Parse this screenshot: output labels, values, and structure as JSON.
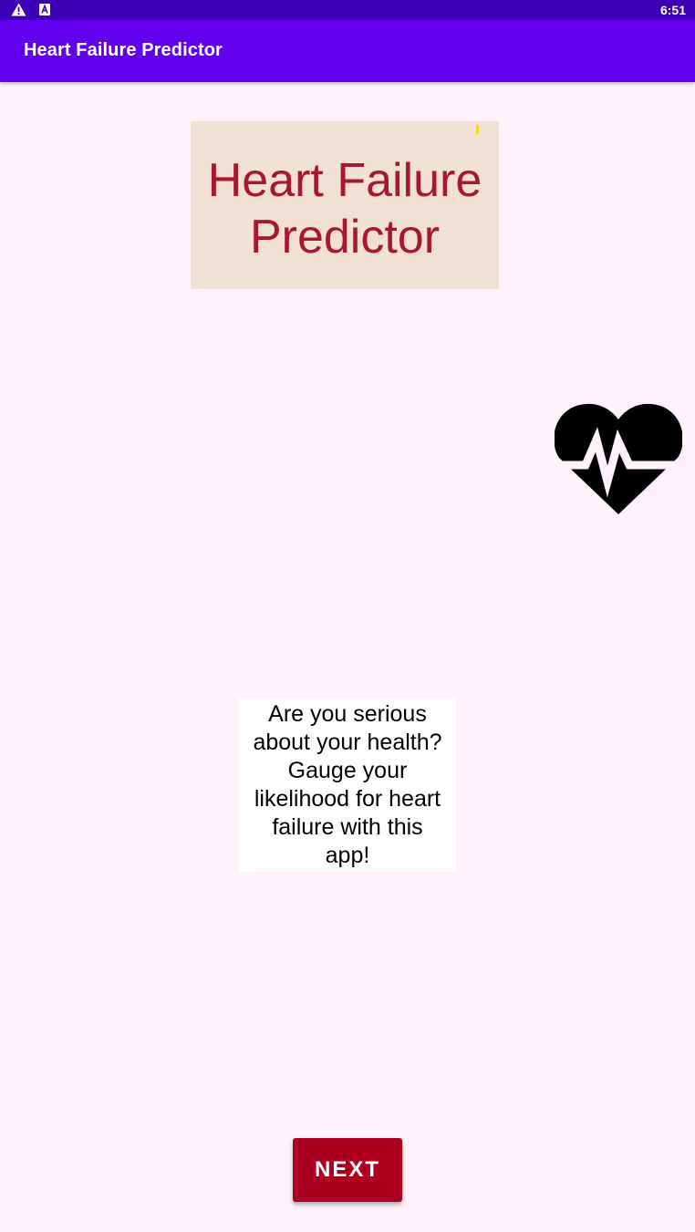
{
  "status_bar": {
    "time": "6:51",
    "icons": [
      "warning-icon",
      "font-a-icon"
    ],
    "color": "#3F00B5"
  },
  "app_bar": {
    "title": "Heart Failure Predictor",
    "color": "#6200EE"
  },
  "banner": {
    "title_line1": "Heart Failure",
    "title_line2": "Predictor",
    "background": "#F1E1D5",
    "text_color": "#A8172C"
  },
  "heart_image": {
    "icon": "heartbeat-icon"
  },
  "message": {
    "line1": "Are you serious",
    "line2": "about your health?",
    "line3": "Gauge your",
    "line4": "likelihood for heart",
    "line5": "failure with this",
    "line6": "app!"
  },
  "next_button": {
    "label": "NEXT",
    "color": "#AD0020"
  },
  "page": {
    "background": "#FFF2FB"
  }
}
